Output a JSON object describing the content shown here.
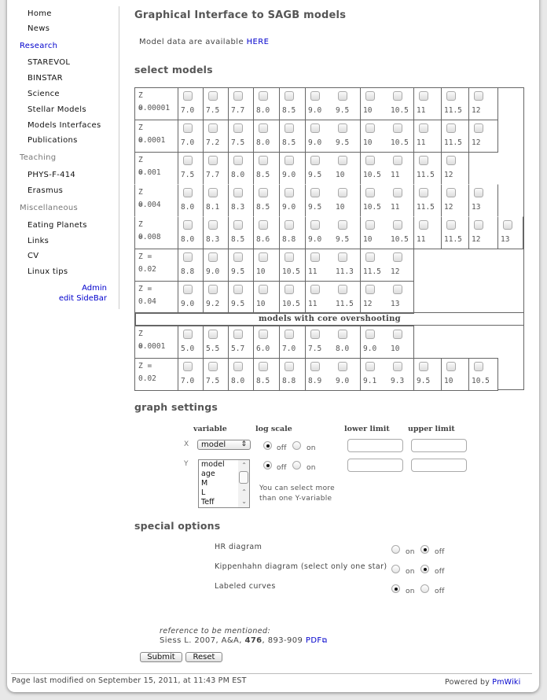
{
  "sidebar": {
    "items": [
      {
        "label": "Home",
        "type": "link"
      },
      {
        "label": "News",
        "type": "link"
      },
      {
        "label": "Research",
        "type": "heading-link"
      },
      {
        "label": "STAREVOL",
        "type": "link"
      },
      {
        "label": "BINSTAR",
        "type": "link"
      },
      {
        "label": "Science",
        "type": "link"
      },
      {
        "label": "Stellar Models",
        "type": "link"
      },
      {
        "label": "Models Interfaces",
        "type": "link"
      },
      {
        "label": "Publications",
        "type": "link"
      },
      {
        "label": "Teaching",
        "type": "heading"
      },
      {
        "label": "PHYS-F-414",
        "type": "link"
      },
      {
        "label": "Erasmus",
        "type": "link"
      },
      {
        "label": "Miscellaneous",
        "type": "heading"
      },
      {
        "label": "Eating Planets",
        "type": "link"
      },
      {
        "label": "Links",
        "type": "link"
      },
      {
        "label": "CV",
        "type": "link"
      },
      {
        "label": "Linux tips",
        "type": "link"
      }
    ],
    "admin_label": "Admin",
    "edit_sidebar_label": "edit SideBar"
  },
  "page": {
    "title": "Graphical Interface to SAGB models",
    "model_data_text": "Model data are available",
    "model_data_link": "HERE"
  },
  "select_models": {
    "heading": "select models",
    "rows": [
      {
        "z_label": [
          "Z =",
          "0.00001"
        ],
        "masses": [
          "7.0",
          "7.5",
          "7.7",
          "8.0",
          "8.5",
          "9.0",
          "9.5",
          "10",
          "10.5",
          "11",
          "11.5",
          "12"
        ]
      },
      {
        "z_label": [
          "Z =",
          "0.0001"
        ],
        "masses": [
          "7.0",
          "7.2",
          "7.5",
          "8.0",
          "8.5",
          "9.0",
          "9.5",
          "10",
          "10.5",
          "11",
          "11.5",
          "12"
        ]
      },
      {
        "z_label": [
          "Z =",
          "0.001"
        ],
        "masses": [
          "7.5",
          "7.7",
          "8.0",
          "8.5",
          "9.0",
          "9.5",
          "10",
          "10.5",
          "11",
          "11.5",
          "12"
        ]
      },
      {
        "z_label": [
          "Z =",
          "0.004"
        ],
        "masses": [
          "8.0",
          "8.1",
          "8.3",
          "8.5",
          "9.0",
          "9.5",
          "10",
          "10.5",
          "11",
          "11.5",
          "12",
          "13"
        ]
      },
      {
        "z_label": [
          "Z =",
          "0.008"
        ],
        "masses": [
          "8.0",
          "8.3",
          "8.5",
          "8.6",
          "8.8",
          "9.0",
          "9.5",
          "10",
          "10.5",
          "11",
          "11.5",
          "12",
          "13"
        ]
      },
      {
        "z_label": [
          "Z = 0.02"
        ],
        "masses": [
          "8.8",
          "9.0",
          "9.5",
          "10",
          "10.5",
          "11",
          "11.3",
          "11.5",
          "12"
        ]
      },
      {
        "z_label": [
          "Z = 0.04"
        ],
        "masses": [
          "9.0",
          "9.2",
          "9.5",
          "10",
          "10.5",
          "11",
          "11.5",
          "12",
          "13"
        ]
      }
    ],
    "overshooting_heading": "models with core overshooting",
    "overshooting_rows": [
      {
        "z_label": [
          "Z =",
          "0.0001"
        ],
        "masses": [
          "5.0",
          "5.5",
          "5.7",
          "6.0",
          "7.0",
          "7.5",
          "8.0",
          "9.0",
          "10"
        ]
      },
      {
        "z_label": [
          "Z = 0.02"
        ],
        "masses": [
          "7.0",
          "7.5",
          "8.0",
          "8.5",
          "8.8",
          "8.9",
          "9.0",
          "9.1",
          "9.3",
          "9.5",
          "10",
          "10.5"
        ]
      }
    ]
  },
  "graph_settings": {
    "heading": "graph settings",
    "col_variable": "variable",
    "col_log_scale": "log scale",
    "col_lower": "lower limit",
    "col_upper": "upper limit",
    "x_label": "X",
    "y_label": "Y",
    "x_variable_selected": "model",
    "y_variable_options": [
      "model",
      "age",
      "M",
      "L",
      "Teff"
    ],
    "log_off_label": "off",
    "log_on_label": "on",
    "x_log": "off",
    "y_log": "off",
    "x_lower": "",
    "x_upper": "",
    "y_lower": "",
    "y_upper": "",
    "hint_line1": "You can select more",
    "hint_line2": "than one Y-variable"
  },
  "special_options": {
    "heading": "special options",
    "on_label": "on",
    "off_label": "off",
    "options": [
      {
        "label": "HR diagram",
        "value": "off"
      },
      {
        "label": "Kippenhahn diagram (select only one star)",
        "value": "off"
      },
      {
        "label": "Labeled curves",
        "value": "on"
      }
    ]
  },
  "reference": {
    "intro": "reference to be mentioned:",
    "citation_pre": "Siess L. 2007, A&A,",
    "volume": "476",
    "pages": ", 893-909",
    "pdf_link": "PDF"
  },
  "buttons": {
    "submit": "Submit",
    "reset": "Reset"
  },
  "footer": {
    "last_modified": "Page last modified on September 15, 2011, at 11:43 PM EST",
    "powered_by": "Powered by",
    "pmwiki_link": "PmWiki"
  }
}
